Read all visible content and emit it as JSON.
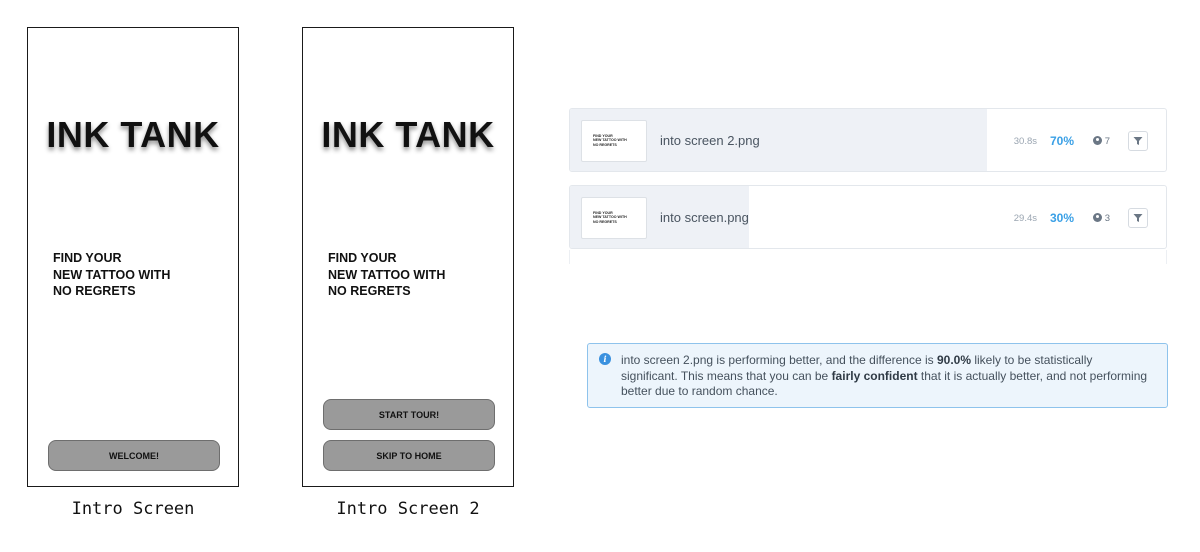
{
  "screens": [
    {
      "caption": "Intro Screen",
      "brand": "INK TANK",
      "tagline": [
        "FIND YOUR",
        "NEW TATTOO WITH",
        "NO REGRETS"
      ],
      "buttons": [
        "WELCOME!"
      ]
    },
    {
      "caption": "Intro Screen 2",
      "brand": "INK TANK",
      "tagline": [
        "FIND YOUR",
        "NEW TATTOO WITH",
        "NO REGRETS"
      ],
      "buttons": [
        "START TOUR!",
        "SKIP TO HOME"
      ]
    }
  ],
  "results": [
    {
      "file": "into screen 2.png",
      "thumb_text": [
        "FIND YOUR",
        "NEW TATTOO WITH",
        "NO REGRETS"
      ],
      "time": "30.8s",
      "percent": "70%",
      "share": 0.7,
      "users": "7",
      "icons": {
        "users": "user-circle-icon",
        "filter": "filter-icon"
      }
    },
    {
      "file": "into screen.png",
      "thumb_text": [
        "FIND YOUR",
        "NEW TATTOO WITH",
        "NO REGRETS"
      ],
      "time": "29.4s",
      "percent": "30%",
      "share": 0.3,
      "users": "3",
      "icons": {
        "users": "user-circle-icon",
        "filter": "filter-icon"
      }
    }
  ],
  "notice": {
    "icon": "info-icon",
    "part1": "into screen 2.png is performing better, and the difference is ",
    "probability": "90.0%",
    "part2": " likely to be statistically significant. This means that you can be ",
    "confidence": "fairly confident",
    "part3": " that it is actually better, and not performing better due to random chance."
  },
  "colors": {
    "accent": "#3aa0e6",
    "notice_border": "#8ec3ec",
    "notice_bg": "#edf5fc",
    "mock_button": "#9a9a9a"
  }
}
